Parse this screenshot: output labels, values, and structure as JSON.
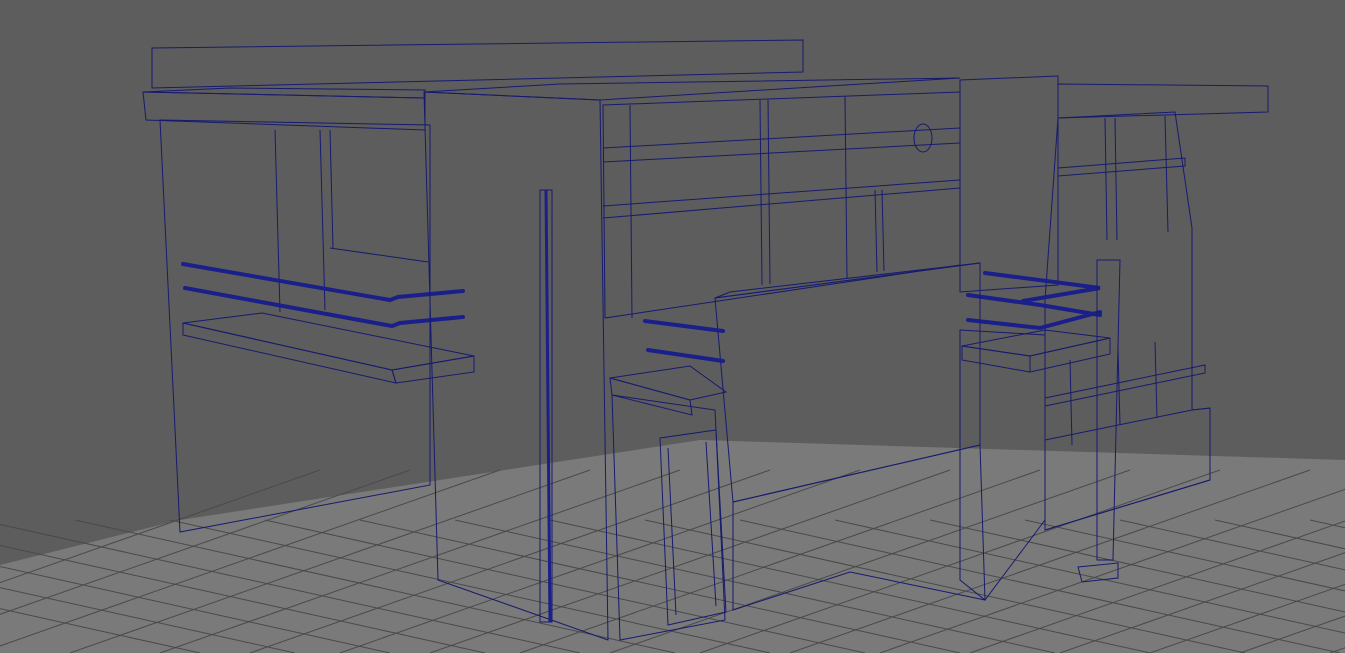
{
  "viewport": {
    "background_color": "#5d5d5d",
    "floor_color": "#7a7a7a",
    "grid_line_color": "#4a4a4a",
    "mesh_face_color": "#8a8a8a",
    "mesh_face_light": "#949494",
    "mesh_face_dark": "#7c7c7c",
    "wireframe_color": "#161b6e",
    "selected_rail_color": "#1a1f8a"
  },
  "scene": {
    "object_type": "polygon-mesh-house",
    "shading_mode": "wireframe-on-shaded"
  }
}
